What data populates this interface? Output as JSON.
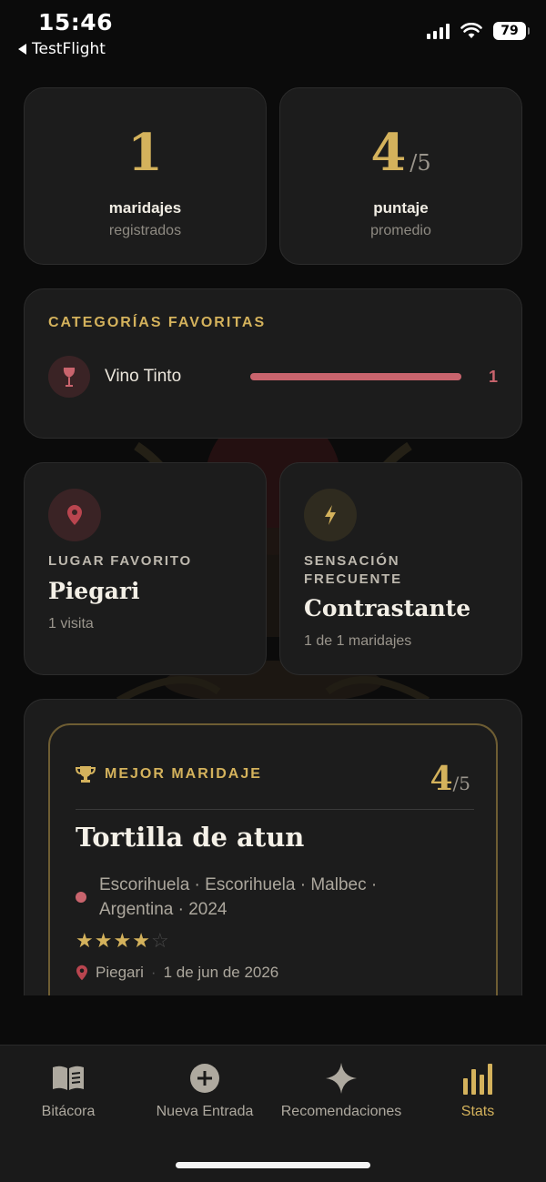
{
  "status_bar": {
    "time": "15:46",
    "back_label": "TestFlight",
    "battery": "79"
  },
  "stats": [
    {
      "value": "1",
      "suffix": "",
      "label": "maridajes",
      "sub": "registrados"
    },
    {
      "value": "4",
      "suffix": "/5",
      "label": "puntaje",
      "sub": "promedio"
    }
  ],
  "categories": {
    "title": "CATEGORÍAS FAVORITAS",
    "items": [
      {
        "name": "Vino Tinto",
        "count": "1",
        "share": 1.0,
        "icon": "wine-glass-icon"
      }
    ]
  },
  "favorite_place": {
    "label": "LUGAR FAVORITO",
    "value": "Piegari",
    "sub": "1 visita",
    "icon": "location-pin-icon"
  },
  "frequent_sensation": {
    "label_line1": "SENSACIÓN",
    "label_line2": "FRECUENTE",
    "value": "Contrastante",
    "sub": "1 de 1 maridajes",
    "icon": "lightning-icon"
  },
  "best_pairing": {
    "label": "MEJOR MARIDAJE",
    "score": "4",
    "score_suffix": "/5",
    "title": "Tortilla de atun",
    "wine": "Escorihuela · Escorihuela · Malbec · Argentina · 2024",
    "rating": 4,
    "rating_max": 5,
    "place": "Piegari",
    "date": "1 de jun de 2026"
  },
  "tabs": [
    {
      "label": "Bitácora",
      "icon": "book-icon",
      "active": false
    },
    {
      "label": "Nueva Entrada",
      "icon": "plus-circle-icon",
      "active": false
    },
    {
      "label": "Recomendaciones",
      "icon": "sparkle-icon",
      "active": false
    },
    {
      "label": "Stats",
      "icon": "bar-chart-icon",
      "active": true
    }
  ],
  "colors": {
    "gold": "#d4b25c",
    "wine": "#c9646d",
    "card": "#1c1c1c",
    "background": "#0b0b0b"
  }
}
